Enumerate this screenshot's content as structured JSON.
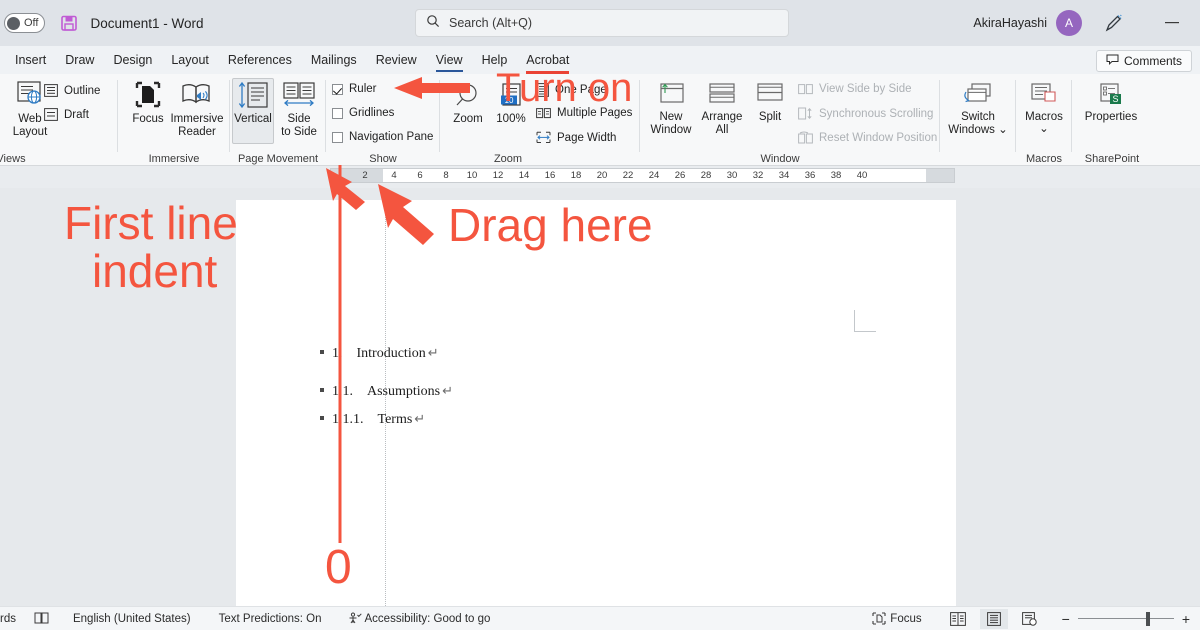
{
  "titlebar": {
    "autosave_label": "Off",
    "autosave_state": "off",
    "document_title": "Document1  -  Word",
    "save_icon": "save-icon",
    "account_name": "AkiraHayashi",
    "avatar_initial": "A",
    "pen_icon": "pen-draw-icon",
    "minimize_icon": "minimize-icon"
  },
  "search": {
    "placeholder": "Search (Alt+Q)",
    "icon": "search-icon"
  },
  "tabs": [
    {
      "label": "Insert",
      "active": false
    },
    {
      "label": "Draw",
      "active": false
    },
    {
      "label": "Design",
      "active": false
    },
    {
      "label": "Layout",
      "active": false
    },
    {
      "label": "References",
      "active": false
    },
    {
      "label": "Mailings",
      "active": false
    },
    {
      "label": "Review",
      "active": false
    },
    {
      "label": "View",
      "active": true
    },
    {
      "label": "Help",
      "active": false
    },
    {
      "label": "Acrobat",
      "active": false
    }
  ],
  "comments_button": {
    "label": "Comments",
    "icon": "comment-balloon-icon"
  },
  "ribbon": {
    "groups": [
      {
        "name": "Views",
        "label": "Views"
      },
      {
        "name": "Immersive",
        "label": "Immersive"
      },
      {
        "name": "Page Movement",
        "label": "Page Movement"
      },
      {
        "name": "Show",
        "label": "Show"
      },
      {
        "name": "Zoom",
        "label": "Zoom"
      },
      {
        "name": "Window",
        "label": "Window"
      },
      {
        "name": "Macros",
        "label": "Macros"
      },
      {
        "name": "SharePoint",
        "label": "SharePoint"
      }
    ],
    "views": {
      "web_layout": "Web\nLayout",
      "web_layout_line1": "Web",
      "web_layout_line2": "Layout",
      "outline": "Outline",
      "draft": "Draft"
    },
    "immersive": {
      "focus": "Focus",
      "immersive_reader_line1": "Immersive",
      "immersive_reader_line2": "Reader"
    },
    "page_movement": {
      "vertical": "Vertical",
      "side_to_side_line1": "Side",
      "side_to_side_line2": "to Side",
      "vertical_selected": true
    },
    "show": {
      "ruler": "Ruler",
      "ruler_checked": true,
      "gridlines": "Gridlines",
      "gridlines_checked": false,
      "navigation_pane": "Navigation Pane",
      "navigation_pane_checked": false
    },
    "zoom": {
      "zoom": "Zoom",
      "percent": "100%",
      "one_page": "One Page",
      "multiple_pages": "Multiple Pages",
      "page_width": "Page Width"
    },
    "window": {
      "new_window_line1": "New",
      "new_window_line2": "Window",
      "arrange_all_line1": "Arrange",
      "arrange_all_line2": "All",
      "split": "Split",
      "view_side_by_side": "View Side by Side",
      "synchronous_scrolling": "Synchronous Scrolling",
      "reset_window_position": "Reset Window Position",
      "disabled_items": true
    },
    "macros": {
      "switch_windows_line1": "Switch",
      "switch_windows_line2": "Windows",
      "macros": "Macros"
    },
    "sharepoint": {
      "properties": "Properties"
    }
  },
  "ruler": {
    "numbers": [
      "2",
      "4",
      "6",
      "8",
      "10",
      "12",
      "14",
      "16",
      "18",
      "20",
      "22",
      "24",
      "26",
      "28",
      "30",
      "32",
      "34",
      "36",
      "38",
      "40"
    ],
    "first_line_indent_position": "0",
    "hanging_indent_marker": "hanging-indent-marker",
    "first_line_marker": "first-line-indent-marker",
    "right_indent_marker": "right-indent-marker"
  },
  "document": {
    "lines": [
      {
        "number": "1.",
        "text": "Introduction",
        "mark": "↵",
        "indent": 0
      },
      {
        "number": "1.1.",
        "text": "Assumptions",
        "mark": "↵",
        "indent": 0
      },
      {
        "number": "1.1.1.",
        "text": "Terms",
        "mark": "↵",
        "indent": 0
      }
    ]
  },
  "statusbar": {
    "word_count": "rds",
    "proofing_icon": "proofing-icon",
    "language": "English (United States)",
    "text_predictions": "Text Predictions: On",
    "accessibility": "Accessibility: Good to go",
    "accessibility_icon": "accessibility-icon",
    "focus": "Focus",
    "focus_icon": "focus-icon",
    "view_read_mode": "read-mode-icon",
    "view_print_layout": "print-layout-icon",
    "view_web_layout": "web-layout-icon",
    "zoom_out": "−",
    "zoom_in": "+",
    "zoom_value": "100"
  },
  "annotations": {
    "color": "#f4553f",
    "turn_on": "Turn on",
    "first_line_indent_l1": "First line",
    "first_line_indent_l2": "indent",
    "drag_here": "Drag here",
    "zero": "0",
    "arrow_to_ruler_checkbox": "arrow-icon",
    "arrow_to_indent_marker": "arrow-icon",
    "arrow_to_ruler_left": "arrow-icon",
    "vertical_guide_line": "vertical-line"
  }
}
